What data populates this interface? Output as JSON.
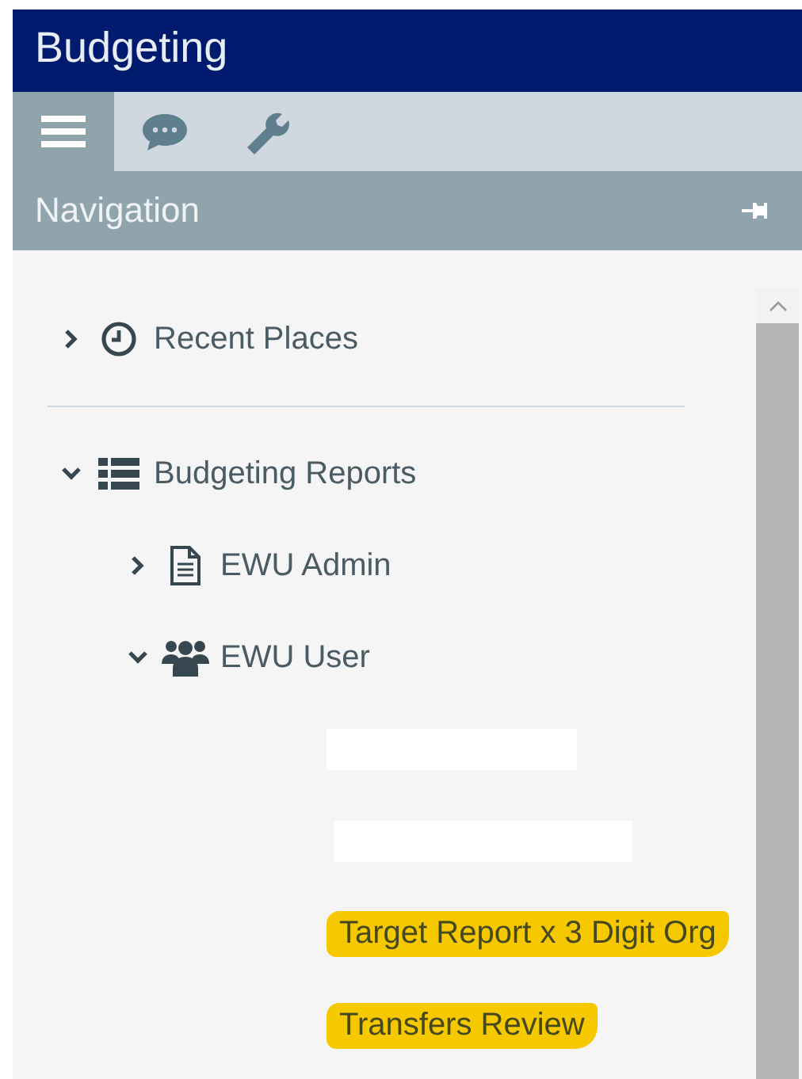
{
  "window": {
    "title": "Budgeting"
  },
  "tabs": [
    {
      "selected": true
    },
    {
      "selected": false
    },
    {
      "selected": false
    }
  ],
  "panel": {
    "title": "Navigation"
  },
  "tree": [
    {
      "label": "Recent Places",
      "expanded": false
    },
    {
      "label": "Budgeting Reports",
      "expanded": true,
      "children": [
        {
          "label": "EWU Admin",
          "expanded": false
        },
        {
          "label": "EWU User",
          "expanded": true,
          "children": [
            {
              "kind": "redacted"
            },
            {
              "kind": "redacted"
            },
            {
              "kind": "link",
              "label": "Target Report x 3 Digit Org",
              "highlighted": true
            },
            {
              "kind": "link",
              "label": "Transfers Review",
              "highlighted": true
            }
          ]
        }
      ]
    }
  ]
}
